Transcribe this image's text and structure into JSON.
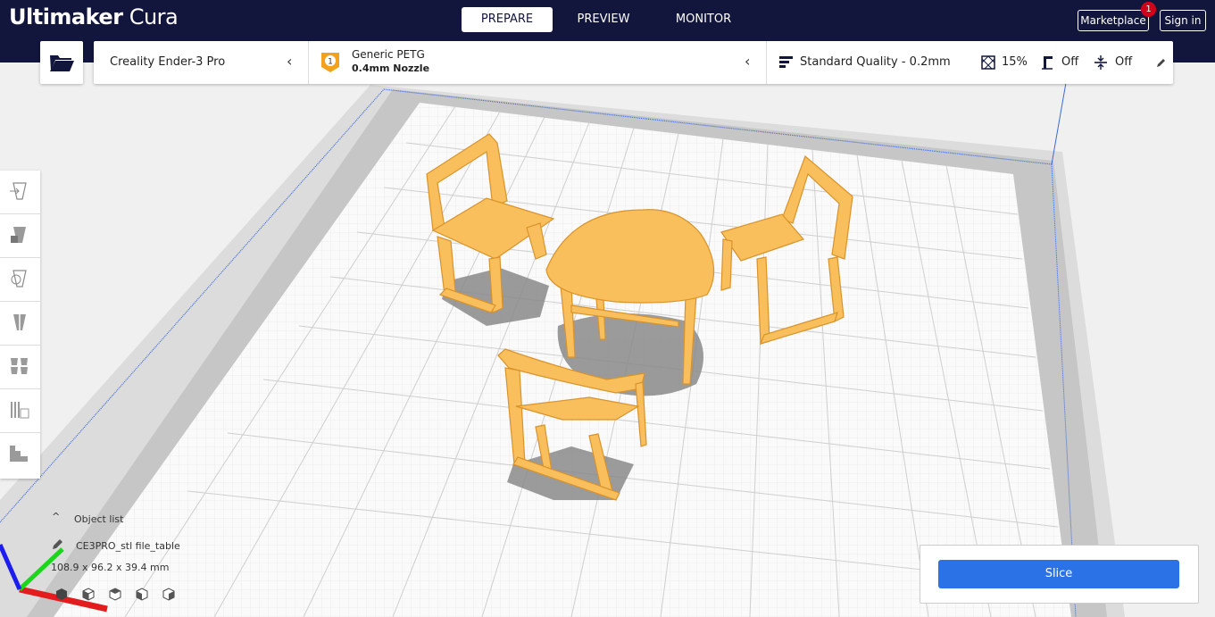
{
  "app": {
    "title_bold": "Ultimaker",
    "title_light": "Cura"
  },
  "stages": [
    {
      "label": "PREPARE",
      "active": true
    },
    {
      "label": "PREVIEW",
      "active": false
    },
    {
      "label": "MONITOR",
      "active": false
    }
  ],
  "header": {
    "marketplace_label": "Marketplace",
    "marketplace_badge": "1",
    "signin_label": "Sign in"
  },
  "printer": {
    "name": "Creality Ender-3 Pro"
  },
  "material": {
    "extruder_number": "1",
    "name": "Generic PETG",
    "nozzle": "0.4mm Nozzle"
  },
  "print_settings": {
    "quality": "Standard Quality - 0.2mm",
    "infill": "15%",
    "support": "Off",
    "adhesion": "Off"
  },
  "toolbar": {
    "tools": [
      "move-tool",
      "scale-tool",
      "rotate-tool",
      "mirror-tool",
      "per-model-settings-tool",
      "support-blocker-tool",
      "layers-tool"
    ]
  },
  "object_list": {
    "label": "Object list",
    "object_name": "CE3PRO_stl file_table",
    "dimensions": "108.9 x 96.2 x 39.4 mm"
  },
  "slice": {
    "label": "Slice"
  },
  "colors": {
    "header_bg": "#12163d",
    "accent": "#2a72e5",
    "model": "#f9bf5c",
    "badge": "#d0021b",
    "material_badge": "#f4a21e"
  }
}
